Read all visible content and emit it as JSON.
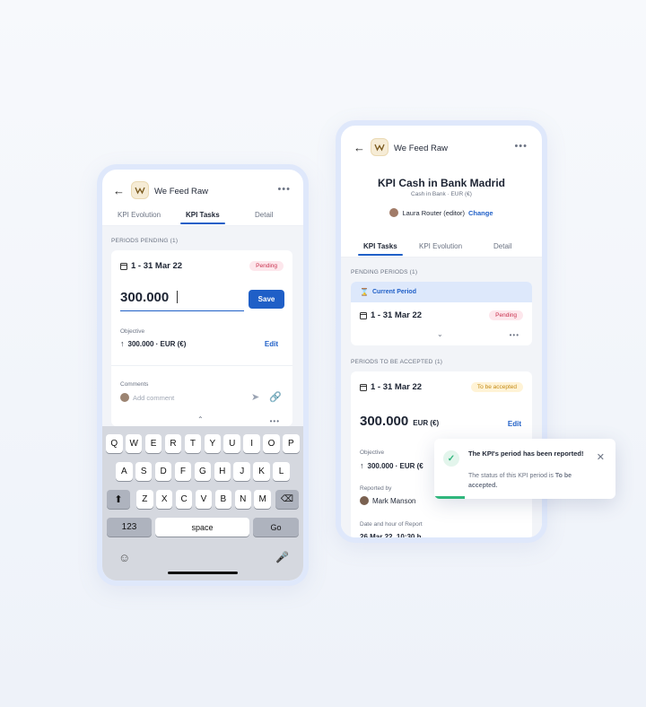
{
  "colors": {
    "accent": "#1f5fc7",
    "success": "#2fb67c",
    "pending": "#c9304e",
    "warning": "#c48a14",
    "bg": "#eef2f9"
  },
  "left_phone": {
    "app_title": "We Feed Raw",
    "tabs": [
      "KPI Evolution",
      "KPI Tasks",
      "Detail"
    ],
    "active_tab": "KPI Tasks",
    "section_label": "PERIODS PENDING (1)",
    "period": {
      "date": "1 - 31 Mar 22",
      "status": "Pending"
    },
    "input_value": "300.000",
    "save_label": "Save",
    "objective_label": "Objective",
    "objective_value": "300.000 · EUR (€)",
    "edit_label": "Edit",
    "comments_label": "Comments",
    "comment_placeholder": "Add comment",
    "keyboard": {
      "row1": [
        "Q",
        "W",
        "E",
        "R",
        "T",
        "Y",
        "U",
        "I",
        "O",
        "P"
      ],
      "row2": [
        "A",
        "S",
        "D",
        "F",
        "G",
        "H",
        "J",
        "K",
        "L"
      ],
      "row3": [
        "Z",
        "X",
        "C",
        "V",
        "B",
        "N",
        "M"
      ],
      "numbers_key": "123",
      "space_key": "space",
      "go_key": "Go"
    }
  },
  "right_phone": {
    "app_title": "We Feed Raw",
    "kpi_title": "KPI Cash in Bank Madrid",
    "kpi_subtitle": "Cash in Bank · EUR (€)",
    "owner_name": "Laura Router",
    "owner_role": "(editor)",
    "change_label": "Change",
    "tabs": [
      "KPI Tasks",
      "KPI Evolution",
      "Detail"
    ],
    "active_tab": "KPI Tasks",
    "pending_label": "PENDING PERIODS (1)",
    "current_period_label": "Current Period",
    "pending_period": {
      "date": "1 - 31 Mar 22",
      "status": "Pending"
    },
    "accepted_label": "PERIODS TO BE ACCEPTED (1)",
    "accepted_period": {
      "date": "1 - 31 Mar 22",
      "status": "To be accepted"
    },
    "value": "300.000",
    "unit": "EUR (€)",
    "edit_label": "Edit",
    "objective_label": "Objective",
    "objective_value": "300.000 · EUR (€",
    "reported_by_label": "Reported by",
    "reported_by_name": "Mark Manson",
    "date_label": "Date and hour of Report",
    "date_value": "26 Mar 22, 10:30 h"
  },
  "toast": {
    "title": "The KPI's period  has been reported!",
    "body_prefix": "The status of this KPI period is ",
    "body_bold": "To be accepted."
  }
}
